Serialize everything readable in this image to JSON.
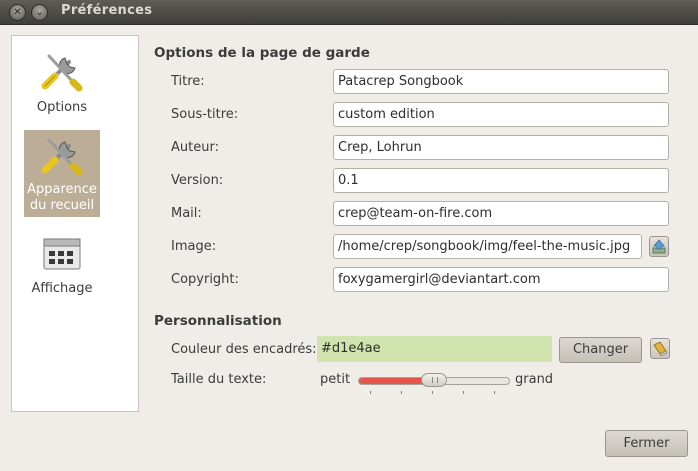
{
  "window": {
    "title": "Préférences"
  },
  "sidebar": {
    "items": [
      {
        "label": "Options",
        "icon": "tools-icon"
      },
      {
        "label_line1": "Apparence",
        "label_line2": "du recueil",
        "icon": "tools-icon",
        "selected": true
      },
      {
        "label": "Affichage",
        "icon": "display-icon"
      }
    ]
  },
  "cover_section": {
    "title": "Options de la page de garde",
    "fields": [
      {
        "label": "Titre:",
        "value": "Patacrep Songbook"
      },
      {
        "label": "Sous-titre:",
        "value": "custom edition"
      },
      {
        "label": "Auteur:",
        "value": "Crep, Lohrun"
      },
      {
        "label": "Version:",
        "value": "0.1"
      },
      {
        "label": "Mail:",
        "value": "crep@team-on-fire.com"
      },
      {
        "label": "Image:",
        "value": "/home/crep/songbook/img/feel-the-music.jpg"
      },
      {
        "label": "Copyright:",
        "value": "foxygamergirl@deviantart.com"
      }
    ]
  },
  "custom_section": {
    "title": "Personnalisation",
    "box_color_label": "Couleur des encadrés:",
    "box_color_value": "#d1e4ae",
    "box_color": "#d1e4ae",
    "change_button": "Changer",
    "text_size_label": "Taille du texte:",
    "slider_min_label": "petit",
    "slider_max_label": "grand",
    "slider_value_fraction": 0.5
  },
  "footer": {
    "close_button": "Fermer"
  },
  "colors": {
    "accent": "#e2574c",
    "selection": "#bcad96"
  }
}
